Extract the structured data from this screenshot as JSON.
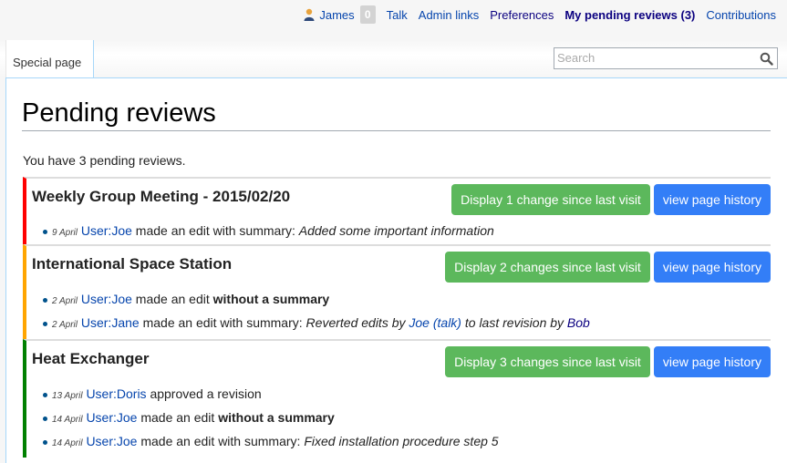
{
  "personal_bar": {
    "username": "James",
    "notification_count": "0",
    "links": [
      {
        "label": "Talk",
        "bold": false
      },
      {
        "label": "Admin links",
        "bold": false
      },
      {
        "label": "Preferences",
        "bold": false
      },
      {
        "label": "My pending reviews (3)",
        "bold": true
      },
      {
        "label": "Contributions",
        "bold": false
      }
    ]
  },
  "tabs": {
    "special_page": "Special page"
  },
  "search": {
    "placeholder": "Search",
    "value": ""
  },
  "page": {
    "title": "Pending reviews",
    "summary": "You have 3 pending reviews."
  },
  "reviews": [
    {
      "title": "Weekly Group Meeting - 2015/02/20",
      "status_color": "#ff0000",
      "display_label": "Display 1 change since last visit",
      "history_label": "view page history",
      "items": [
        {
          "date": "9 April",
          "user": "User:Joe",
          "action": "made an edit with summary:",
          "summary": "Added some important information"
        }
      ]
    },
    {
      "title": "International Space Station",
      "status_color": "#ffa500",
      "display_label": "Display 2 changes since last visit",
      "history_label": "view page history",
      "items": [
        {
          "date": "2 April",
          "user": "User:Joe",
          "action": "made an edit",
          "bold": "without a summary"
        },
        {
          "date": "2 April",
          "user": "User:Jane",
          "action": "made an edit with summary:",
          "summary_parts": [
            "Reverted edits by ",
            "Joe",
            " ",
            "(talk)",
            " to last revision by ",
            "Bob"
          ]
        }
      ]
    },
    {
      "title": "Heat Exchanger",
      "status_color": "#008000",
      "display_label": "Display 3 changes since last visit",
      "history_label": "view page history",
      "items": [
        {
          "date": "13 April",
          "user": "User:Doris",
          "action": "approved a revision"
        },
        {
          "date": "14 April",
          "user": "User:Joe",
          "action": "made an edit",
          "bold": "without a summary"
        },
        {
          "date": "14 April",
          "user": "User:Joe",
          "action": "made an edit with summary:",
          "summary": "Fixed installation procedure step 5"
        }
      ]
    }
  ]
}
